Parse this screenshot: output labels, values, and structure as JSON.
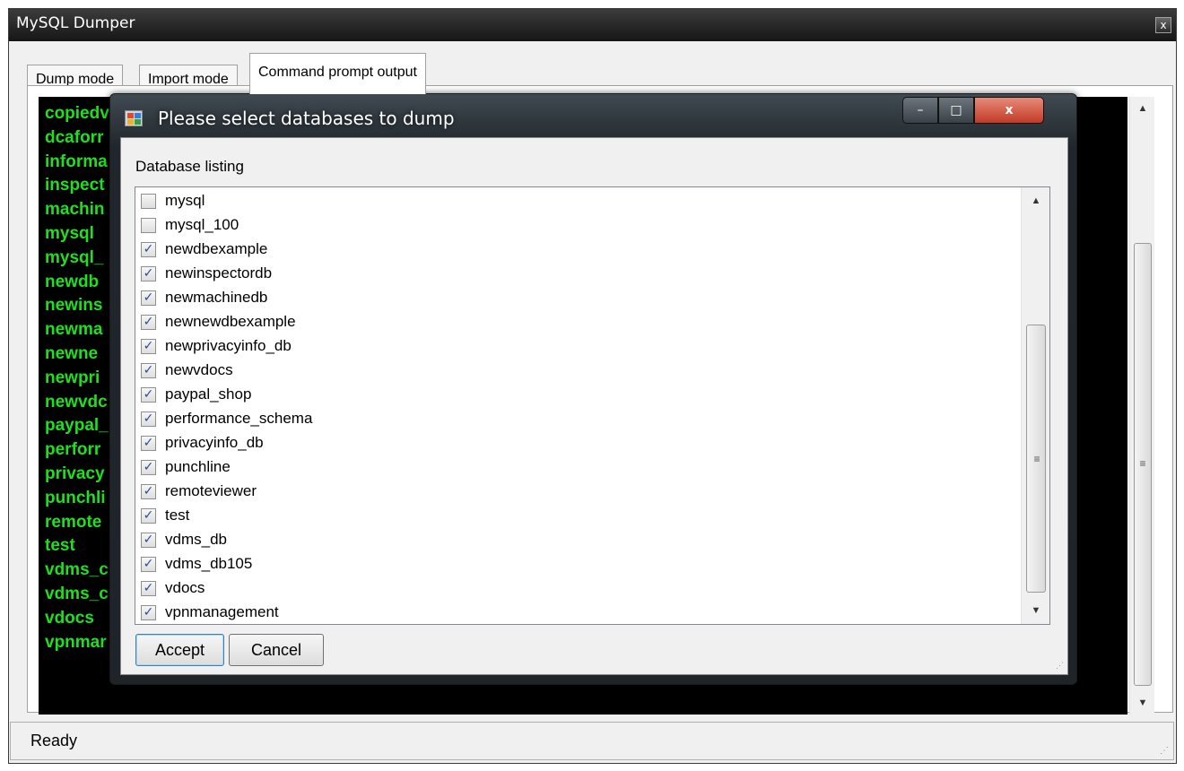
{
  "window": {
    "title": "MySQL Dumper",
    "close_glyph": "x"
  },
  "tabs": [
    {
      "label": "Dump mode",
      "active": false
    },
    {
      "label": "Import mode",
      "active": false
    },
    {
      "label": "Command prompt output",
      "active": true
    }
  ],
  "console": {
    "lines": [
      "copiedv",
      "dcaforr",
      "informa",
      "inspect",
      "machin",
      "mysql",
      "mysql_",
      "newdb",
      "newins",
      "newma",
      "newne",
      "newpri",
      "newvdc",
      "paypal_",
      "perforr",
      "privacy",
      "punchli",
      "remote",
      "test",
      "vdms_c",
      "vdms_c",
      "vdocs",
      "vpnmar"
    ]
  },
  "dialog": {
    "title": "Please select databases to dump",
    "min_glyph": "–",
    "max_glyph": "□",
    "close_glyph": "x",
    "group_label": "Database listing",
    "items": [
      {
        "label": "mysql",
        "checked": false
      },
      {
        "label": "mysql_100",
        "checked": false
      },
      {
        "label": "newdbexample",
        "checked": true
      },
      {
        "label": "newinspectordb",
        "checked": true
      },
      {
        "label": "newmachinedb",
        "checked": true
      },
      {
        "label": "newnewdbexample",
        "checked": true
      },
      {
        "label": "newprivacyinfo_db",
        "checked": true
      },
      {
        "label": "newvdocs",
        "checked": true
      },
      {
        "label": "paypal_shop",
        "checked": true
      },
      {
        "label": "performance_schema",
        "checked": true
      },
      {
        "label": "privacyinfo_db",
        "checked": true
      },
      {
        "label": "punchline",
        "checked": true
      },
      {
        "label": "remoteviewer",
        "checked": true
      },
      {
        "label": "test",
        "checked": true
      },
      {
        "label": "vdms_db",
        "checked": true
      },
      {
        "label": "vdms_db105",
        "checked": true
      },
      {
        "label": "vdocs",
        "checked": true
      },
      {
        "label": "vpnmanagement",
        "checked": true
      }
    ],
    "accept_label": "Accept",
    "cancel_label": "Cancel"
  },
  "status": {
    "text": "Ready"
  },
  "glyphs": {
    "scroll_up": "▲",
    "scroll_down": "▼",
    "scroll_grip": "≡",
    "check": "✓",
    "size_grip": "⋰"
  },
  "colors": {
    "console_text": "#1ee01e",
    "console_bg": "#000000",
    "close_red": "#c23a26"
  }
}
